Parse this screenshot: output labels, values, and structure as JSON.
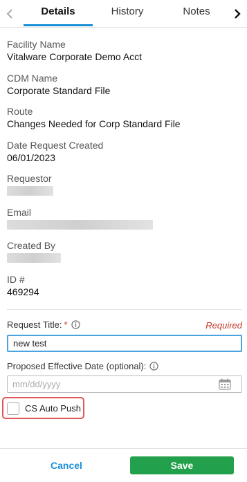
{
  "tabs": [
    {
      "label": "Details",
      "active": true
    },
    {
      "label": "History",
      "active": false
    },
    {
      "label": "Notes",
      "active": false
    }
  ],
  "details": {
    "facility_name": {
      "label": "Facility Name",
      "value": "Vitalware Corporate Demo Acct"
    },
    "cdm_name": {
      "label": "CDM Name",
      "value": "Corporate Standard File"
    },
    "route": {
      "label": "Route",
      "value": "Changes Needed for Corp Standard File"
    },
    "date_request_created": {
      "label": "Date Request Created",
      "value": "06/01/2023"
    },
    "requestor": {
      "label": "Requestor"
    },
    "email": {
      "label": "Email"
    },
    "created_by": {
      "label": "Created By"
    },
    "id": {
      "label": "ID #",
      "value": "469294"
    }
  },
  "form": {
    "request_title": {
      "label": "Request Title:",
      "required_marker": "*",
      "required_text": "Required",
      "value": "new test"
    },
    "effective_date": {
      "label": "Proposed Effective Date (optional):",
      "placeholder": "mm/dd/yyyy"
    },
    "cs_auto_push": {
      "label": "CS Auto Push",
      "checked": false
    }
  },
  "footer": {
    "cancel_label": "Cancel",
    "save_label": "Save"
  },
  "colors": {
    "accent": "#1a8fd6",
    "save": "#23a04b",
    "required": "#c0392b",
    "highlight": "#e05555"
  }
}
